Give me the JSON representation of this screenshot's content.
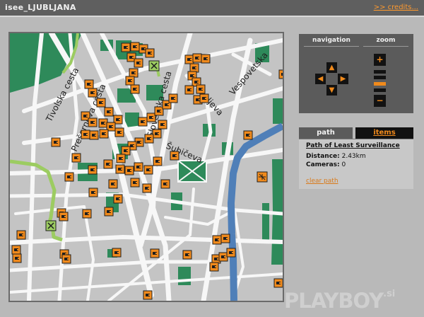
{
  "app": {
    "title": "isee_LJUBLJANA",
    "credits": ">> credits..."
  },
  "map": {
    "street_labels": [
      "Tivolska cesta",
      "Prešernova cesta",
      "Slovenska cesta",
      "Resljeva",
      "Šubičeva",
      "Vespovetska"
    ],
    "colors": {
      "background": "#c4c4c4",
      "road": "#f7f7f7",
      "park": "#2e8a5a",
      "river": "#4f7fb8",
      "route": "#9ccc61",
      "camera": "#f08a1c"
    },
    "camera_icon": "camera-marker-icon",
    "start_icon": "start-marker-icon",
    "end_icon": "end-marker-icon"
  },
  "navigation": {
    "label": "navigation",
    "zoom_label": "zoom",
    "up": "▲",
    "down": "▼",
    "left": "◀",
    "right": "▶",
    "zoom_in": "+",
    "zoom_out": "−",
    "zoom_level": 0.5
  },
  "info": {
    "tabs": [
      "path",
      "items"
    ],
    "active_tab": "path",
    "path_title": "Path of Least Surveillance",
    "distance_label": "Distance:",
    "distance_value": "2.43km",
    "cameras_label": "Cameras:",
    "cameras_value": "0",
    "clear_link": "clear path"
  },
  "watermark": {
    "text": "PLAYBOY",
    "suffix": ".si"
  }
}
